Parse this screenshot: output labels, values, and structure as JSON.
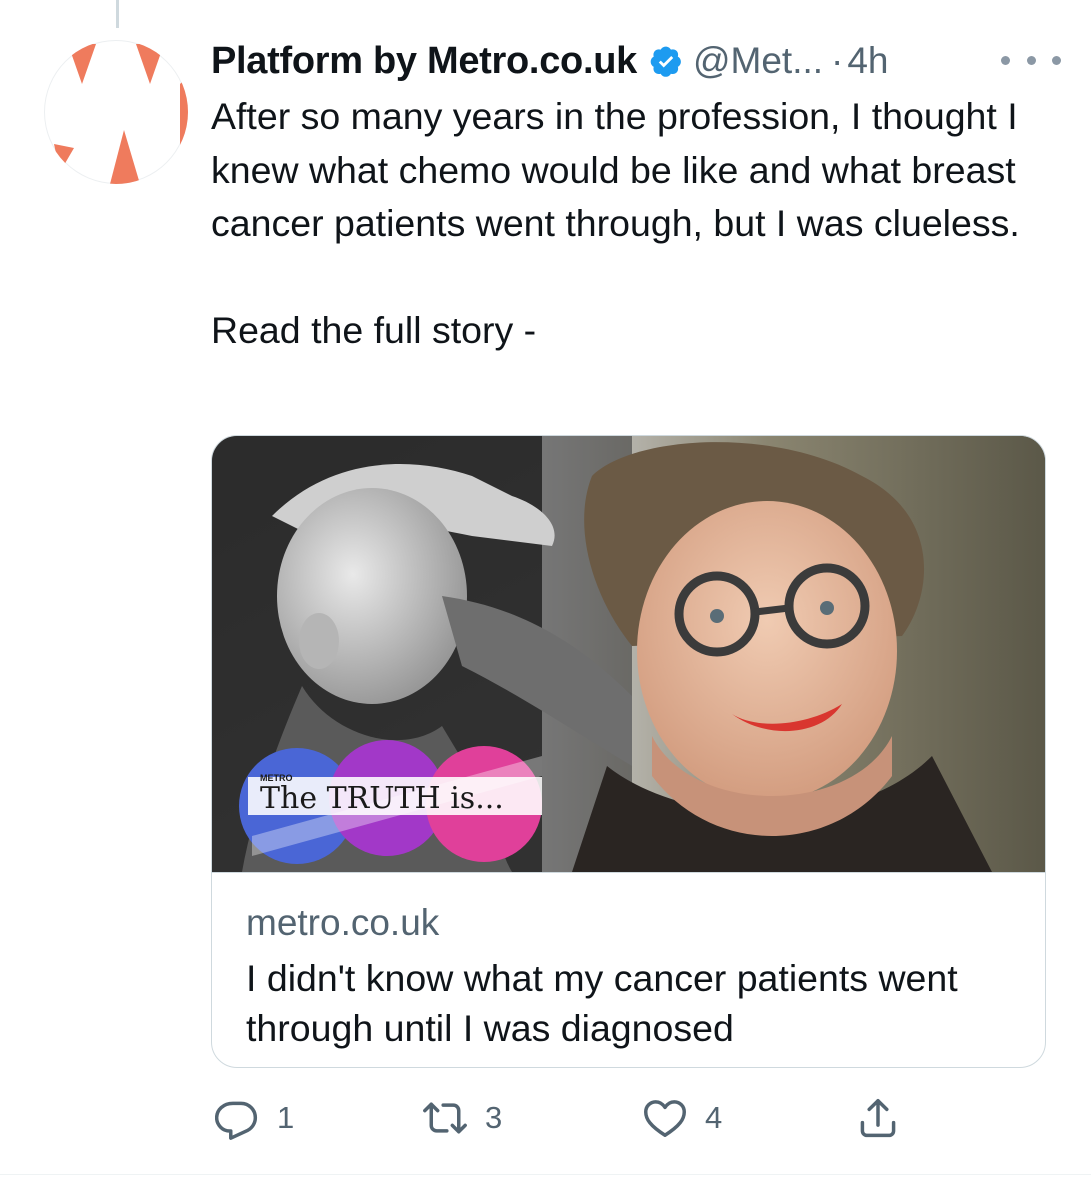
{
  "colors": {
    "accent": "#1d9bf0",
    "secondary_text": "#536471",
    "avatar_brand": "#ef7b5d",
    "truth_blue": "#4a66d6",
    "truth_purple": "#a238c8",
    "truth_pink": "#e0409a"
  },
  "tweet": {
    "display_name": "Platform by Metro.co.uk",
    "verified_icon": "verified-badge-icon",
    "handle": "@Met...",
    "separator": "·",
    "time": "4h",
    "more_icon": "more-dots-icon",
    "text": "After so many years in the profession, I thought I knew what chemo would be like and what breast cancer patients went through, but I was clueless.\n\nRead the full story -"
  },
  "card": {
    "image_icon": "article-photo",
    "image_badge": {
      "brand": "METRO",
      "text": "The TRUTH is..."
    },
    "domain": "metro.co.uk",
    "title": "I didn't know what my cancer patients went through until I was diagnosed"
  },
  "actions": {
    "reply": {
      "icon": "reply-icon",
      "count": "1"
    },
    "retweet": {
      "icon": "retweet-icon",
      "count": "3"
    },
    "like": {
      "icon": "heart-icon",
      "count": "4"
    },
    "share": {
      "icon": "share-icon"
    }
  }
}
